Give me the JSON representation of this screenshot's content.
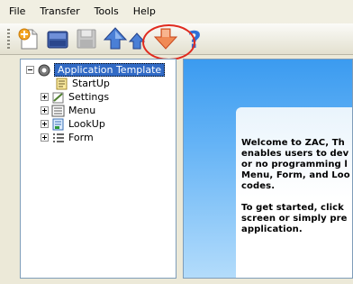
{
  "menu": [
    "File",
    "Transfer",
    "Tools",
    "Help"
  ],
  "toolbar": {
    "buttons": [
      "new-icon",
      "open-icon",
      "save-icon",
      "upload-icon",
      "upload-small-icon",
      "download-icon",
      "help-icon"
    ]
  },
  "tree": {
    "root": "Application Template",
    "items": [
      "StartUp",
      "Settings",
      "Menu",
      "LookUp",
      "Form"
    ]
  },
  "welcome": {
    "lines": [
      "Welcome to ZAC, Th",
      "enables users to dev",
      "or no programming l",
      "Menu, Form, and Loo",
      "codes.",
      "",
      "To get started, click",
      "screen or simply pre",
      "application."
    ]
  },
  "colors": {
    "accent": "#316ac5",
    "panel_blue": "#3b9bf0",
    "highlight_circle": "#e02a1e"
  }
}
